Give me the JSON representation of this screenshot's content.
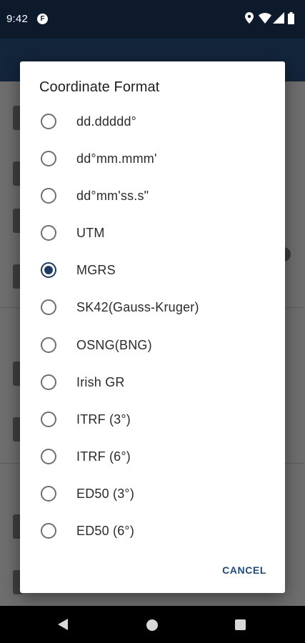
{
  "status_bar": {
    "time": "9:42",
    "app_icon_glyph": "F",
    "icons": [
      "location-icon",
      "wifi-icon",
      "signal-icon",
      "battery-icon"
    ]
  },
  "dialog": {
    "title": "Coordinate Format",
    "selected_index": 4,
    "options": [
      "dd.ddddd°",
      "dd°mm.mmm'",
      "dd°mm'ss.s\"",
      "UTM",
      "MGRS",
      "SK42(Gauss-Kruger)",
      "OSNG(BNG)",
      "Irish GR",
      "ITRF (3°)",
      "ITRF (6°)",
      "ED50 (3°)",
      "ED50 (6°)"
    ],
    "cancel_label": "CANCEL"
  },
  "colors": {
    "accent": "#1f3a60",
    "cancel_text": "#1f4a7c",
    "scrim": "#6e6e6e",
    "app_bar": "#13253b"
  }
}
